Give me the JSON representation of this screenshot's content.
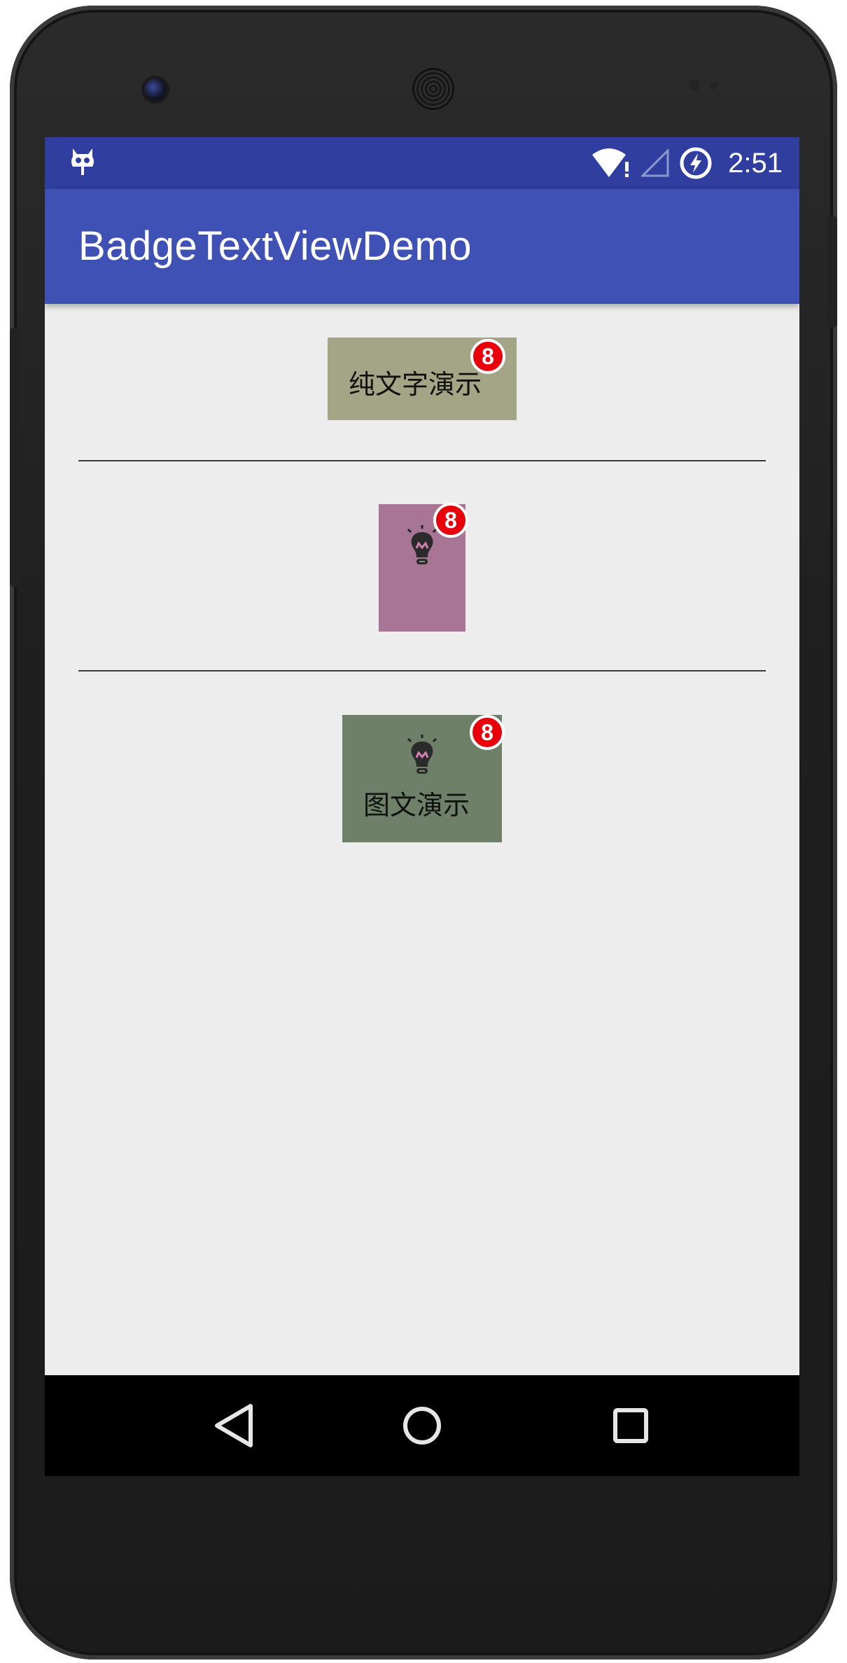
{
  "status_bar": {
    "time": "2:51",
    "icons": [
      "cyanogen-mascot-icon",
      "wifi-icon",
      "cell-signal-icon",
      "battery-charging-icon"
    ]
  },
  "app_bar": {
    "title": "BadgeTextViewDemo"
  },
  "demos": [
    {
      "type": "text",
      "label": "纯文字演示",
      "badge": "8",
      "background": "#a4a586"
    },
    {
      "type": "image",
      "label": "",
      "badge": "8",
      "background": "#a97595",
      "icon": "lightbulb-icon"
    },
    {
      "type": "image-text",
      "label": "图文演示",
      "badge": "8",
      "background": "#6e8068",
      "icon": "lightbulb-icon"
    }
  ],
  "nav_bar": {
    "buttons": [
      "back-button",
      "home-button",
      "recents-button"
    ]
  },
  "colors": {
    "status_bar": "#303f9f",
    "app_bar": "#3f51b5",
    "content_bg": "#ededed",
    "badge": "#e8000b"
  }
}
